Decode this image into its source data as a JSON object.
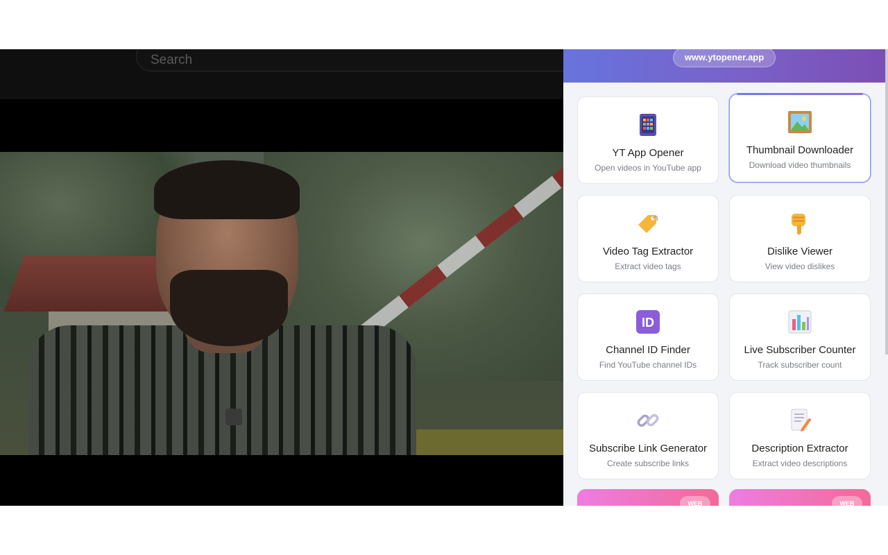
{
  "youtube": {
    "search_placeholder": "Search"
  },
  "extension": {
    "url": "www.ytopener.app",
    "colors": {
      "header_start": "#6674dd",
      "header_end": "#7b4fb5",
      "accent": "#8c97ee",
      "pink_start": "#ee7de2",
      "pink_end": "#f26a97"
    },
    "tools": [
      {
        "title": "YT App Opener",
        "subtitle": "Open videos in YouTube app",
        "icon": "phone-grid-icon"
      },
      {
        "title": "Thumbnail Downloader",
        "subtitle": "Download video thumbnails",
        "icon": "framed-picture-icon"
      },
      {
        "title": "Video Tag Extractor",
        "subtitle": "Extract video tags",
        "icon": "tag-icon"
      },
      {
        "title": "Dislike Viewer",
        "subtitle": "View video dislikes",
        "icon": "thumbs-down-icon"
      },
      {
        "title": "Channel ID Finder",
        "subtitle": "Find YouTube channel IDs",
        "icon": "id-icon"
      },
      {
        "title": "Live Subscriber Counter",
        "subtitle": "Track subscriber count",
        "icon": "bar-chart-icon"
      },
      {
        "title": "Subscribe Link Generator",
        "subtitle": "Create subscribe links",
        "icon": "link-icon"
      },
      {
        "title": "Description Extractor",
        "subtitle": "Extract video descriptions",
        "icon": "memo-icon"
      }
    ],
    "partial_badges": [
      "WEB",
      "WEB"
    ]
  }
}
